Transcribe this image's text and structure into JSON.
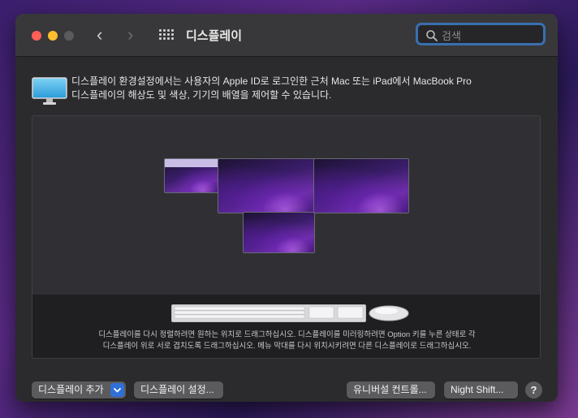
{
  "window": {
    "title": "디스플레이",
    "search": {
      "placeholder": "검색",
      "value": ""
    }
  },
  "description": {
    "line1": "디스플레이 환경설정에서는 사용자의 Apple ID로 로그인한 근처 Mac 또는 iPad에서 MacBook Pro",
    "line2": "디스플레이의 해상도 및 색상, 기기의 배열을 제어할 수 있습니다."
  },
  "arrangement": {
    "displays": [
      {
        "id": "display-1",
        "has_menubar": true
      },
      {
        "id": "display-2",
        "has_menubar": false
      },
      {
        "id": "display-3",
        "has_menubar": false
      },
      {
        "id": "display-4",
        "has_menubar": false
      }
    ],
    "instructions": {
      "line1": "디스플레이를 다시 정렬하려면 원하는 위치로 드래그하십시오. 디스플레이를 미러링하려면 Option 키를 누른 상태로 각",
      "line2": "디스플레이 위로 서로 겹치도록 드래그하십시오. 메뉴 막대를 다시 위치시키려면 다른 디스플레이로 드래그하십시오."
    }
  },
  "buttons": {
    "add_display": "디스플레이 추가",
    "display_settings": "디스플레이 설정...",
    "universal_control": "유니버설 컨트롤...",
    "night_shift": "Night Shift...",
    "help": "?"
  },
  "colors": {
    "accent": "#2f6fd8",
    "close": "#ff5f57",
    "minimize": "#febc2e"
  },
  "icons": [
    "close-icon",
    "minimize-icon",
    "zoom-icon",
    "back-chevron-icon",
    "forward-chevron-icon",
    "grid-icon",
    "search-icon",
    "monitor-icon",
    "keyboard-icon",
    "mouse-icon",
    "chevron-down-icon"
  ]
}
